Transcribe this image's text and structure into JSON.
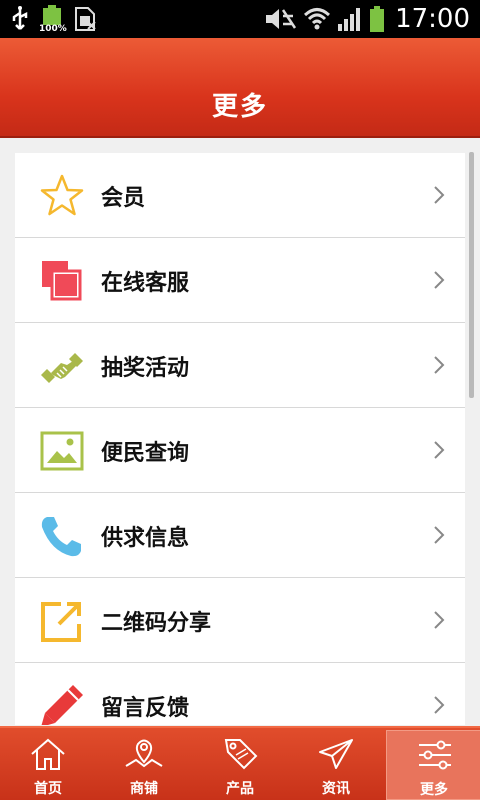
{
  "status_bar": {
    "battery_percent_text": "100%",
    "time": "17:00",
    "icons": [
      "usb-icon",
      "battery-small-icon",
      "sim-icon",
      "mute-icon",
      "wifi-icon",
      "signal-icon",
      "battery-icon"
    ]
  },
  "header": {
    "title": "更多"
  },
  "menu": {
    "items": [
      {
        "label": "会员",
        "icon": "star-icon",
        "color": "#f5b82e"
      },
      {
        "label": "在线客服",
        "icon": "chat-copy-icon",
        "color": "#f04a58"
      },
      {
        "label": "抽奖活动",
        "icon": "handshake-icon",
        "color": "#a9b84a"
      },
      {
        "label": "便民查询",
        "icon": "image-icon",
        "color": "#a9c24a"
      },
      {
        "label": "供求信息",
        "icon": "phone-icon",
        "color": "#5bbbe8"
      },
      {
        "label": "二维码分享",
        "icon": "share-icon",
        "color": "#f5b82e"
      },
      {
        "label": "留言反馈",
        "icon": "pencil-icon",
        "color": "#e83a3a"
      }
    ]
  },
  "tabs": [
    {
      "label": "首页",
      "icon": "home-icon",
      "active": false
    },
    {
      "label": "商铺",
      "icon": "map-icon",
      "active": false
    },
    {
      "label": "产品",
      "icon": "sale-tag-icon",
      "active": false
    },
    {
      "label": "资讯",
      "icon": "send-icon",
      "active": false
    },
    {
      "label": "更多",
      "icon": "settings-sliders-icon",
      "active": true
    }
  ],
  "colors": {
    "header": "#d9341c",
    "tabbar": "#c83219",
    "active_tab": "#e8745c"
  }
}
